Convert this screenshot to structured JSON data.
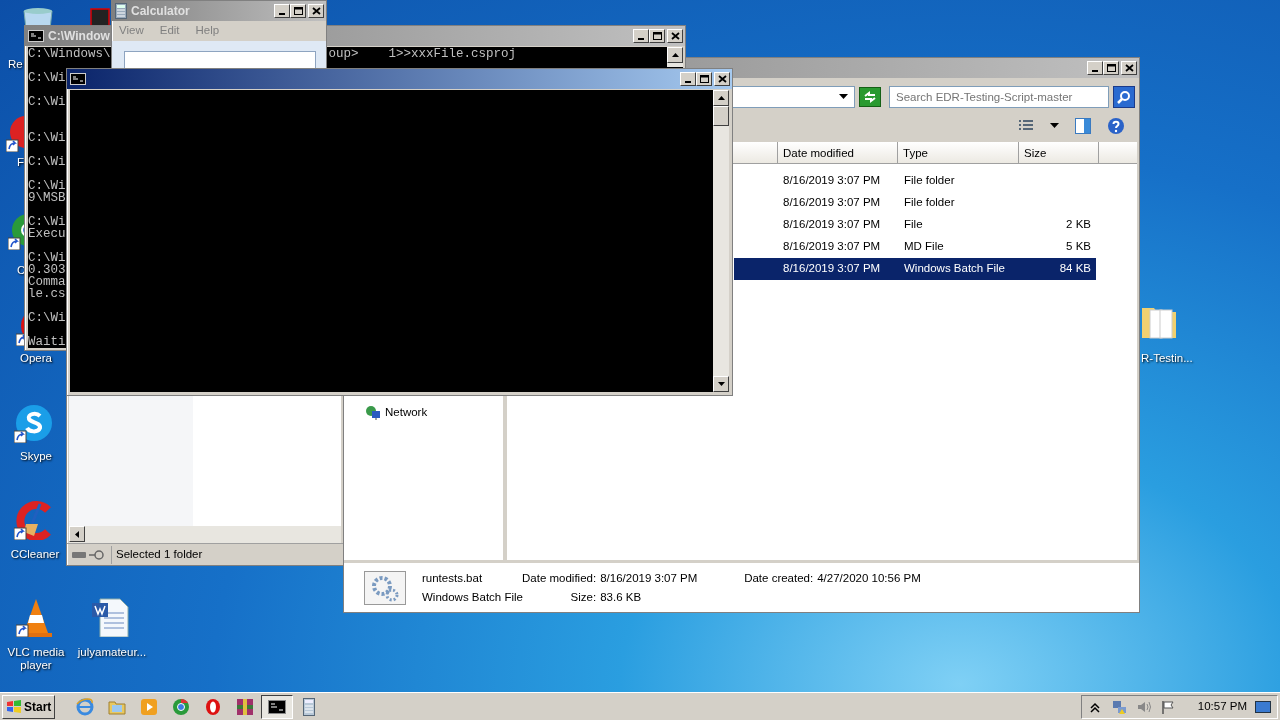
{
  "desktop_icons": [
    {
      "label": "Re",
      "kind": "recycle"
    },
    {
      "kind": "app"
    },
    {
      "label": "F",
      "kind": "red-app"
    },
    {
      "label": "C",
      "kind": "chrome"
    },
    {
      "label": "Opera",
      "kind": "opera"
    },
    {
      "label": "Skype",
      "kind": "skype"
    },
    {
      "label": "CCleaner",
      "kind": "ccleaner"
    },
    {
      "label": "VLC media player",
      "kind": "vlc"
    },
    {
      "label": "julyamateur...",
      "kind": "word"
    },
    {
      "label": "R-Testin...",
      "kind": "folder"
    }
  ],
  "explorer_back": {
    "status": "Selected 1 folder"
  },
  "explorer": {
    "active": false,
    "search": {
      "placeholder": "Search EDR-Testing-Script-master"
    },
    "columns": [
      "Date modified",
      "Type",
      "Size"
    ],
    "rows": [
      {
        "date": "8/16/2019 3:07 PM",
        "type": "File folder",
        "selected": false
      },
      {
        "date": "8/16/2019 3:07 PM",
        "type": "File folder",
        "selected": false
      },
      {
        "date": "8/16/2019 3:07 PM",
        "type": "File",
        "size": "2 KB",
        "selected": false
      },
      {
        "date": "8/16/2019 3:07 PM",
        "type": "MD File",
        "size": "5 KB",
        "selected": false
      },
      {
        "date": "8/16/2019 3:07 PM",
        "type": "Windows Batch File",
        "size": "84 KB",
        "selected": true
      }
    ],
    "nav": [
      {
        "label": "Network"
      }
    ],
    "details": {
      "name": "runtests.bat",
      "type": "Windows Batch File",
      "fields": [
        {
          "label": "Date modified:",
          "value": "8/16/2019 3:07 PM"
        },
        {
          "label": "Size:",
          "value": "83.6 KB"
        },
        {
          "label": "Date created:",
          "value": "4/27/2020 10:56 PM"
        }
      ]
    }
  },
  "cmd_back": {
    "active": false,
    "title": "C:\\Window",
    "first_line": {
      "start": "C:\\Windows\\",
      "end": "oup>    1>>xxxFile.csproj"
    },
    "blocks": [
      [
        "C:\\Wi"
      ],
      [
        "C:\\Wi"
      ],
      [
        "C:\\Wi"
      ],
      [
        "C:\\Wi"
      ],
      [
        "C:\\Wi",
        "9\\MSB"
      ],
      [
        "C:\\Wi",
        "Execu"
      ],
      [
        "C:\\Wi",
        "0.303",
        "Comma",
        "le.cs"
      ],
      [
        "C:\\Wi"
      ],
      [
        "Waiti"
      ]
    ]
  },
  "calculator": {
    "active": false,
    "title": "Calculator",
    "menu": [
      "View",
      "Edit",
      "Help"
    ]
  },
  "cmd_front": {
    "active": true
  },
  "taskbar": {
    "start": "Start",
    "buttons": [
      {
        "kind": "ie",
        "selected": false
      },
      {
        "kind": "folder",
        "selected": false
      },
      {
        "kind": "media",
        "selected": false
      },
      {
        "kind": "chrome",
        "selected": false
      },
      {
        "kind": "opera",
        "selected": false
      },
      {
        "kind": "winrar",
        "selected": false
      },
      {
        "kind": "cmd",
        "selected": true
      },
      {
        "kind": "calculator",
        "selected": false
      }
    ],
    "clock": "10:57 PM"
  }
}
